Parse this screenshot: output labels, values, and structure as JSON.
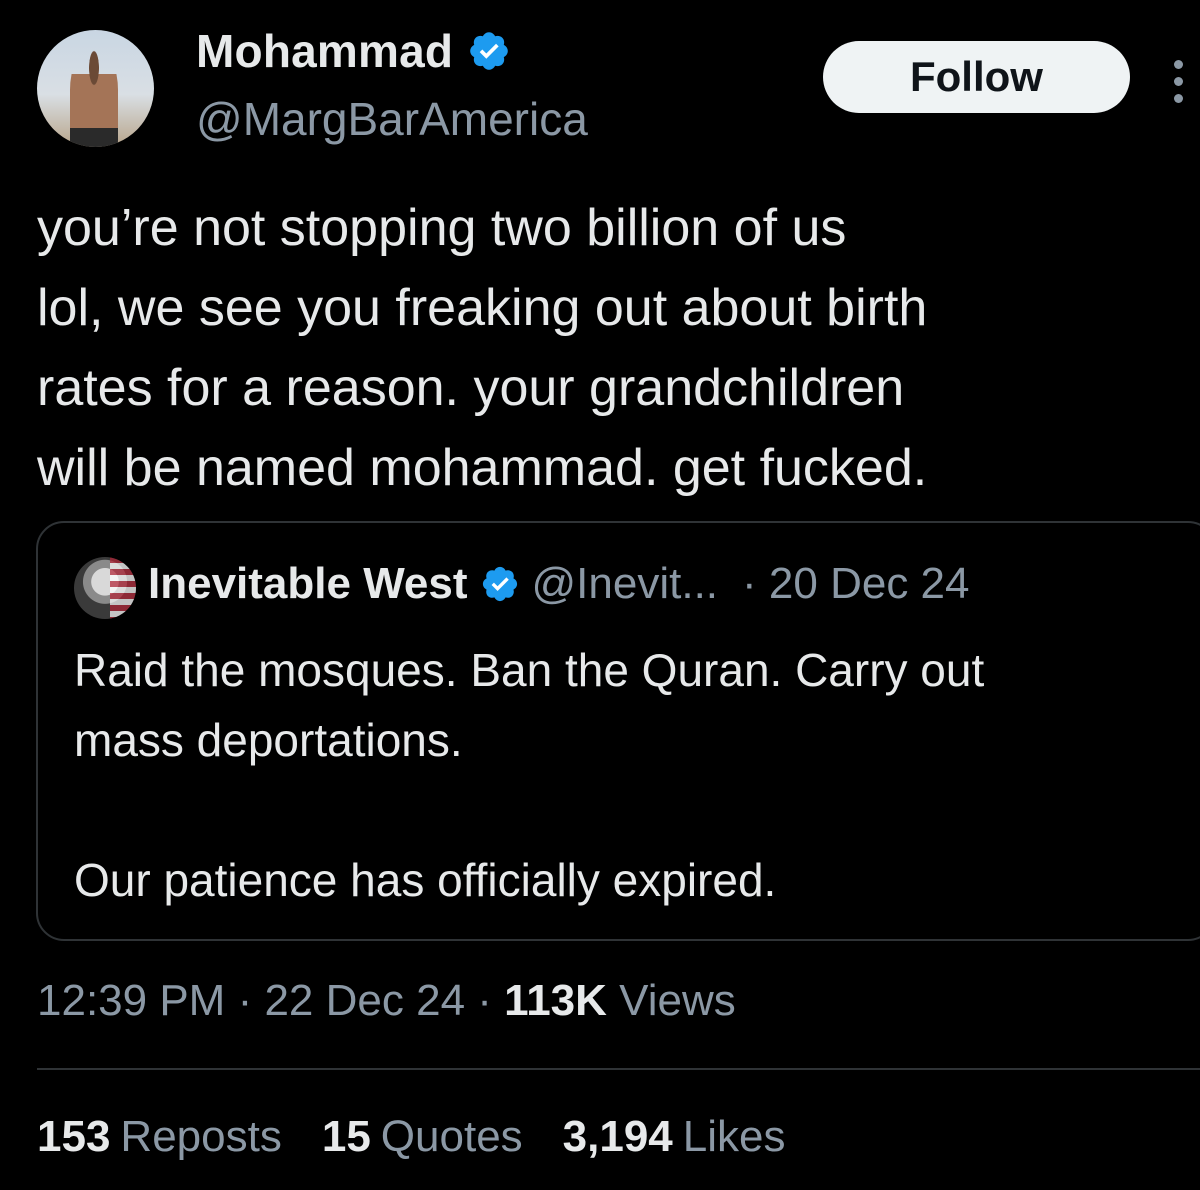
{
  "author": {
    "name": "Mohammad",
    "handle": "@MargBarAmerica",
    "verified_badge": "verified-badge-icon",
    "follow_label": "Follow"
  },
  "tweet": {
    "text": "you’re not stopping two billion of us\nlol, we see you freaking out about birth\nrates for a reason. your grandchildren\nwill be named mohammad. get fucked."
  },
  "quoted": {
    "name": "Inevitable West",
    "handle": "@Inevit...",
    "date": "· 20 Dec 24",
    "text": "Raid the mosques. Ban the Quran. Carry out\nmass deportations.\n\nOur patience has officially expired."
  },
  "meta": {
    "time": "12:39 PM",
    "date": "· 22 Dec 24 ·",
    "views_count": "113K",
    "views_label": "Views"
  },
  "stats": {
    "reposts_count": "153",
    "reposts_label": "Reposts",
    "quotes_count": "15",
    "quotes_label": "Quotes",
    "likes_count": "3,194",
    "likes_label": "Likes"
  },
  "colors": {
    "background": "#000000",
    "text": "#e7e9ea",
    "muted": "#8b98a5",
    "verified": "#1d9bf0",
    "border": "#2f3336"
  }
}
